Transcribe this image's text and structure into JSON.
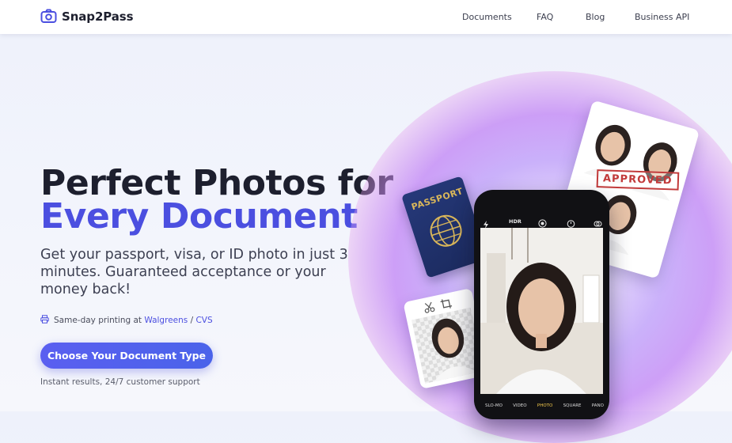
{
  "nav": {
    "brand": "Snap2Pass",
    "links": [
      "Documents",
      "FAQ",
      "Blog",
      "Business API"
    ]
  },
  "hero": {
    "headline_line1": "Perfect Photos for",
    "headline_line2": "Every Document",
    "subheadline": "Get your passport, visa, or ID photo in just 3 minutes. Guaranteed acceptance or your money back!",
    "printing_prefix": "Same-day printing at",
    "printing_links": [
      "Walgreens",
      "CVS"
    ],
    "printing_separator": "/",
    "cta_label": "Choose Your Document Type",
    "footnote": "Instant results, 24/7 customer support"
  },
  "illustration": {
    "passport_label": "PASSPORT",
    "stamp_label": "APPROVED",
    "camera_hdr": "HDR",
    "camera_modes": [
      "SLO-MO",
      "VIDEO",
      "PHOTO",
      "SQUARE",
      "PANO"
    ],
    "active_mode": "PHOTO"
  },
  "colors": {
    "accent": "#4b4fe0",
    "text_dark": "#1d1f2e",
    "stamp_red": "#c23a3a"
  },
  "icons": {
    "logo": "camera-icon",
    "printer": "printer-icon"
  }
}
